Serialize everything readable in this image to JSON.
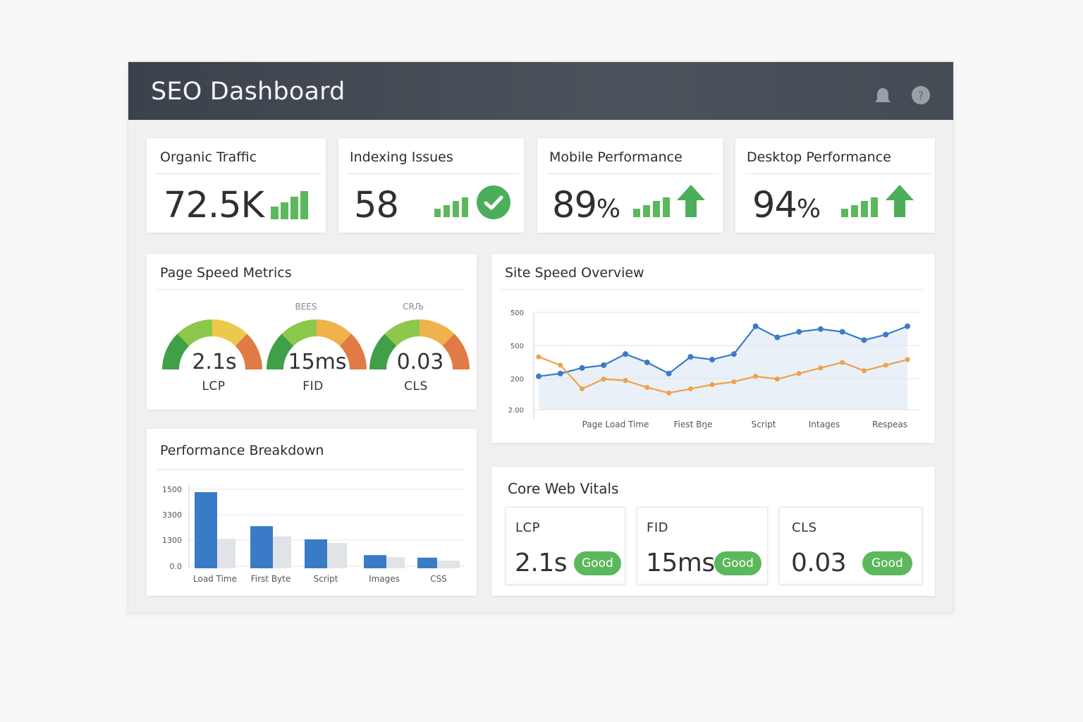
{
  "header": {
    "title": "SEO Dashboard",
    "bell_icon": "bell-icon",
    "help_icon": "help-icon"
  },
  "kpis": [
    {
      "title": "Organic Traffic",
      "value": "72.5K",
      "unit": "",
      "indicator": "bars-icon"
    },
    {
      "title": "Indexing Issues",
      "value": "58",
      "unit": "",
      "indicator": "check-icon"
    },
    {
      "title": "Mobile Performance",
      "value": "89",
      "unit": "%",
      "indicator": "arrow-up-icon"
    },
    {
      "title": "Desktop Performance",
      "value": "94",
      "unit": "%",
      "indicator": "arrow-up-icon"
    }
  ],
  "page_speed": {
    "title": "Page Speed Metrics",
    "gauges": [
      {
        "value": "2.1s",
        "label": "LCP",
        "top_label": ""
      },
      {
        "value": "15ms",
        "label": "FID",
        "top_label": "BEЕS"
      },
      {
        "value": "0.03",
        "label": "CLS",
        "top_label": "CRЉ"
      }
    ]
  },
  "site_speed": {
    "title": "Site Speed Overview"
  },
  "breakdown": {
    "title": "Performance Breakdown"
  },
  "core_web_vitals": {
    "title": "Core Web Vitals",
    "items": [
      {
        "label": "LCP",
        "value": "2.1s",
        "status": "Good"
      },
      {
        "label": "FID",
        "value": "15ms",
        "status": "Good"
      },
      {
        "label": "CLS",
        "value": "0.03",
        "status": "Good"
      }
    ]
  },
  "colors": {
    "blue": "#3a7bc8",
    "orange": "#f0a04b",
    "green": "#5cb85c",
    "gray_bar": "#e0e3e8"
  },
  "chart_data": [
    {
      "type": "line",
      "title": "Site Speed Overview",
      "x_ticks": [
        "Page Load Time",
        "Fiest Bŋe",
        "Script",
        "Intages",
        "Respeas"
      ],
      "y_ticks": [
        "5̈00",
        "500",
        "200",
        "2.00"
      ],
      "x": [
        0,
        1,
        2,
        3,
        4,
        5,
        6,
        7,
        8,
        9,
        10,
        11,
        12,
        13,
        14,
        15,
        16,
        17,
        18
      ],
      "series": [
        {
          "values": [
            270,
            280,
            300,
            310,
            350,
            320,
            280,
            340,
            330,
            350,
            450,
            410,
            430,
            440,
            430,
            400,
            420,
            450
          ]
        },
        {
          "values": [
            340,
            310,
            225,
            260,
            255,
            230,
            210,
            225,
            240,
            250,
            270,
            260,
            280,
            300,
            320,
            290,
            310,
            330
          ]
        }
      ]
    },
    {
      "type": "bar",
      "title": "Performance Breakdown",
      "categories": [
        "Load Time",
        "First Byte",
        "Script",
        "Images",
        "CSS"
      ],
      "y_ticks": [
        "1500",
        "3300",
        "1300",
        "0.0"
      ],
      "series": [
        {
          "values": [
            1500,
            830,
            570,
            260,
            210
          ]
        },
        {
          "values": [
            580,
            630,
            500,
            220,
            150
          ]
        }
      ]
    }
  ]
}
